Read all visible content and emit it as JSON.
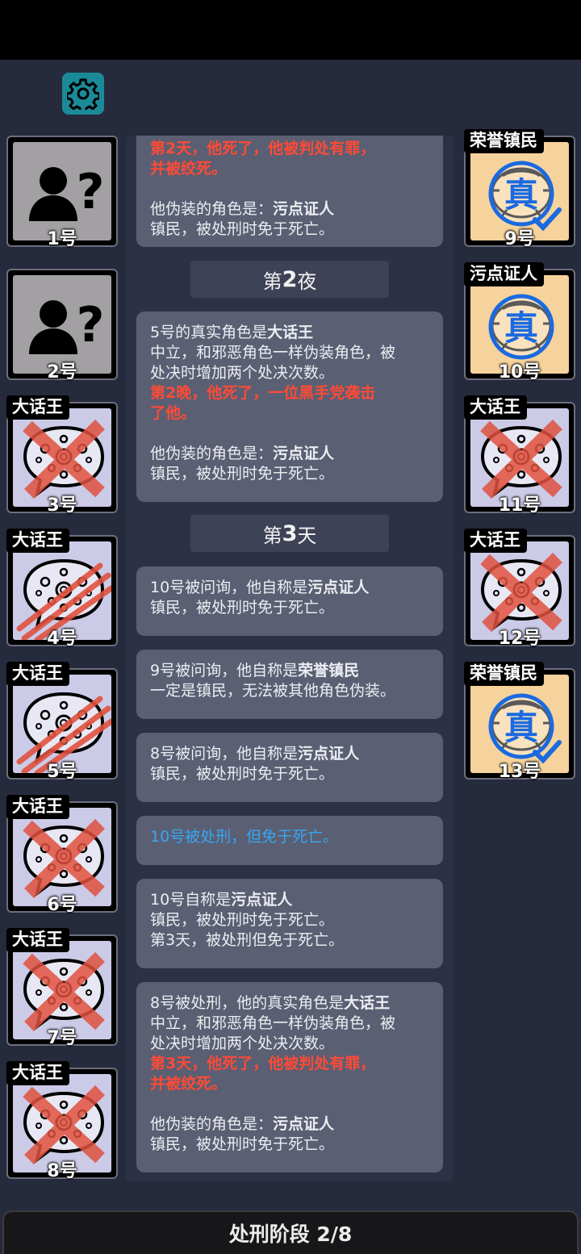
{
  "settings": {
    "icon": "gear-icon"
  },
  "left_tiles": [
    {
      "number": "1号",
      "type": "unknown",
      "icon": "user-question-icon"
    },
    {
      "number": "2号",
      "type": "unknown",
      "icon": "user-question-icon"
    },
    {
      "number": "3号",
      "type": "liar",
      "role": "大话王",
      "mark": "cross-mark-icon"
    },
    {
      "number": "4号",
      "type": "liar",
      "role": "大话王",
      "mark": "claw-mark-icon"
    },
    {
      "number": "5号",
      "type": "liar",
      "role": "大话王",
      "mark": "claw-mark-icon"
    },
    {
      "number": "6号",
      "type": "liar",
      "role": "大话王",
      "mark": "cross-mark-icon"
    },
    {
      "number": "7号",
      "type": "liar",
      "role": "大话王",
      "mark": "cross-mark-icon"
    },
    {
      "number": "8号",
      "type": "liar",
      "role": "大话王",
      "mark": "cross-mark-icon"
    }
  ],
  "right_tiles": [
    {
      "number": "9号",
      "type": "good",
      "role": "荣誉镇民",
      "mark": "verified-true-icon",
      "stamp": "真"
    },
    {
      "number": "10号",
      "type": "good",
      "role": "污点证人",
      "mark": "true-stamp-icon",
      "stamp": "真"
    },
    {
      "number": "11号",
      "type": "liar",
      "role": "大话王",
      "mark": "cross-mark-icon"
    },
    {
      "number": "12号",
      "type": "liar",
      "role": "大话王",
      "mark": "cross-mark-icon"
    },
    {
      "number": "13号",
      "type": "good",
      "role": "荣誉镇民",
      "mark": "verified-true-icon",
      "stamp": "真"
    }
  ],
  "feed": {
    "card0": {
      "line1": "第2天，他死了，他被判处有罪，",
      "line2": "并被绞死。",
      "disguise_prefix": "他伪装的角色是：",
      "disguise_role": "污点证人",
      "disguise_desc": "镇民，被处刑时免于死亡。"
    },
    "header_night2": {
      "prefix": "第",
      "num": "2",
      "suffix": "夜"
    },
    "card1": {
      "prefix": "5号的真实角色是",
      "role": "大话王",
      "desc1": "中立，和邪恶角色一样伪装角色，被",
      "desc2": "处决时增加两个处决次数。",
      "death1": "第2晚，他死了，一位黑手党袭击",
      "death2": "了他。",
      "disguise_prefix": "他伪装的角色是：",
      "disguise_role": "污点证人",
      "disguise_desc": "镇民，被处刑时免于死亡。"
    },
    "header_day3": {
      "prefix": "第",
      "num": "3",
      "suffix": "天"
    },
    "card2": {
      "prefix": "10号被问询，他自称是",
      "role": "污点证人",
      "desc": "镇民，被处刑时免于死亡。"
    },
    "card3": {
      "prefix": "9号被问询，他自称是",
      "role": "荣誉镇民",
      "desc": "一定是镇民，无法被其他角色伪装。"
    },
    "card4": {
      "prefix": "8号被问询，他自称是",
      "role": "污点证人",
      "desc": "镇民，被处刑时免于死亡。"
    },
    "card5": {
      "text": "10号被处刑，但免于死亡。"
    },
    "card6": {
      "prefix": "10号自称是",
      "role": "污点证人",
      "desc": "镇民，被处刑时免于死亡。",
      "note": "第3天，被处刑但免于死亡。"
    },
    "card7": {
      "prefix": "8号被处刑，他的真实角色是",
      "role": "大话王",
      "desc1": "中立，和邪恶角色一样伪装角色，被",
      "desc2": "处决时增加两个处决次数。",
      "death1": "第3天，他死了，他被判处有罪，",
      "death2": "并被绞死。",
      "disguise_prefix": "他伪装的角色是：",
      "disguise_role": "污点证人",
      "disguise_desc": "镇民，被处刑时免于死亡。"
    }
  },
  "phase": {
    "label": "处刑阶段 2/8"
  },
  "colors": {
    "background": "#262a3d",
    "card": "#5a5f73",
    "death_text": "#ff4a36",
    "info_text": "#38a6f2",
    "settings_button": "#1b8a98"
  }
}
